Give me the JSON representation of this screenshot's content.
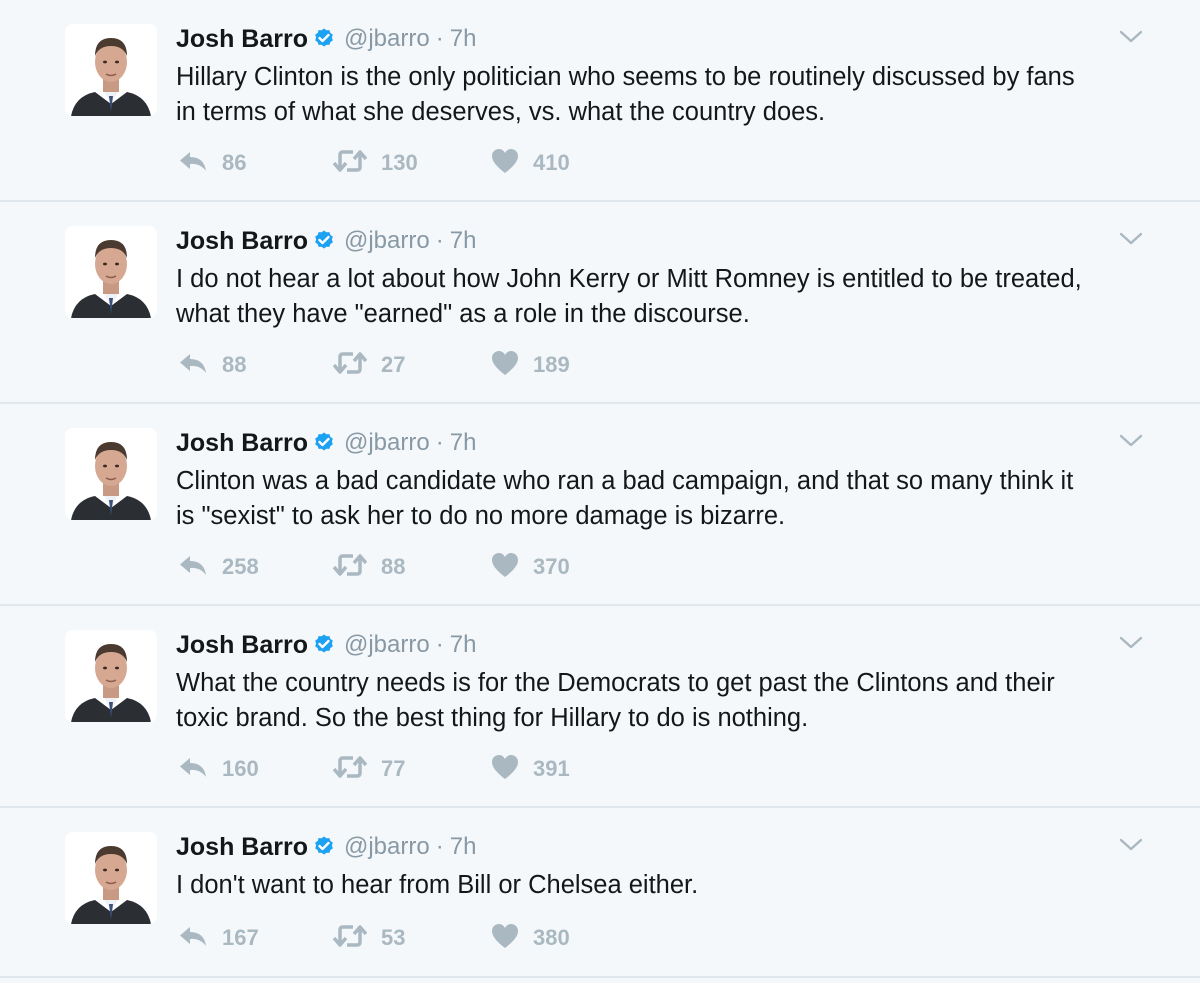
{
  "colors": {
    "background": "#f5f8fa",
    "divider": "#e1e8ed",
    "verified": "#1da1f2",
    "action_gray": "#aab8c2",
    "handle_gray": "#8899a6"
  },
  "icons": {
    "verified": "verified-badge-icon",
    "caret": "chevron-down-icon",
    "reply": "reply-icon",
    "retweet": "retweet-icon",
    "like": "heart-icon"
  },
  "tweets": [
    {
      "name": "Josh Barro",
      "handle": "@jbarro",
      "dot": "·",
      "time": "7h",
      "text": "Hillary Clinton is the only politician who seems to be routinely discussed by fans\nin terms of what she deserves, vs. what the country does.",
      "replies": "86",
      "retweets": "130",
      "likes": "410"
    },
    {
      "name": "Josh Barro",
      "handle": "@jbarro",
      "dot": "·",
      "time": "7h",
      "text": "I do not hear a lot about how John Kerry or Mitt Romney is entitled to be treated,\nwhat they have \"earned\" as a role in the discourse.",
      "replies": "88",
      "retweets": "27",
      "likes": "189"
    },
    {
      "name": "Josh Barro",
      "handle": "@jbarro",
      "dot": "·",
      "time": "7h",
      "text": "Clinton was a bad candidate who ran a bad campaign, and that so many think it\nis \"sexist\" to ask her to do no more damage is bizarre.",
      "replies": "258",
      "retweets": "88",
      "likes": "370"
    },
    {
      "name": "Josh Barro",
      "handle": "@jbarro",
      "dot": "·",
      "time": "7h",
      "text": "What the country needs is for the Democrats to get past the Clintons and their\ntoxic brand. So the best thing for Hillary to do is nothing.",
      "replies": "160",
      "retweets": "77",
      "likes": "391"
    },
    {
      "name": "Josh Barro",
      "handle": "@jbarro",
      "dot": "·",
      "time": "7h",
      "text": "I don't want to hear from Bill or Chelsea either.",
      "replies": "167",
      "retweets": "53",
      "likes": "380"
    }
  ]
}
